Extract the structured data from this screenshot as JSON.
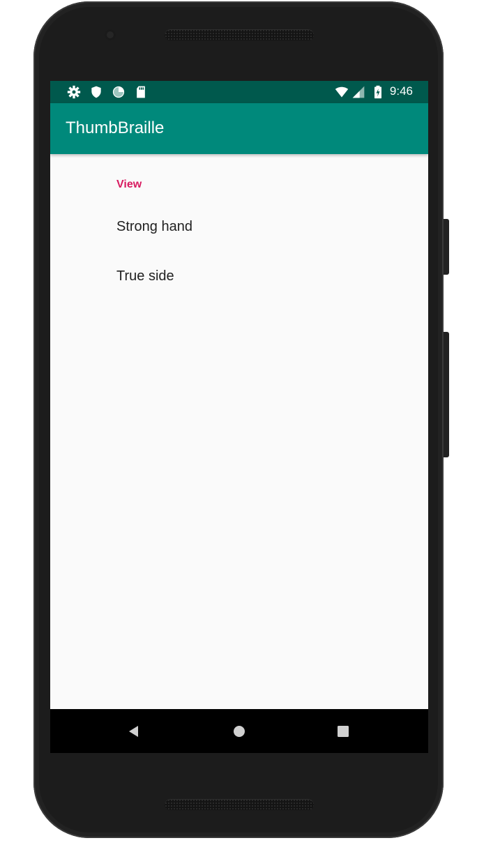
{
  "status_bar": {
    "time": "9:46",
    "icons": [
      "settings-icon",
      "shield-icon",
      "sync-circle-icon",
      "sd-card-icon",
      "wifi-icon",
      "cellular-signal-icon",
      "battery-charging-icon"
    ]
  },
  "app_bar": {
    "title": "ThumbBraille"
  },
  "preferences": {
    "category_title": "View",
    "items": [
      {
        "label": "Strong hand"
      },
      {
        "label": "True side"
      }
    ]
  },
  "nav_bar": {
    "icons": [
      "back-icon",
      "home-icon",
      "recent-apps-icon"
    ]
  },
  "colors": {
    "status_bar": "#00594d",
    "app_bar": "#00897b",
    "accent": "#d81b60",
    "background": "#fafafa"
  }
}
